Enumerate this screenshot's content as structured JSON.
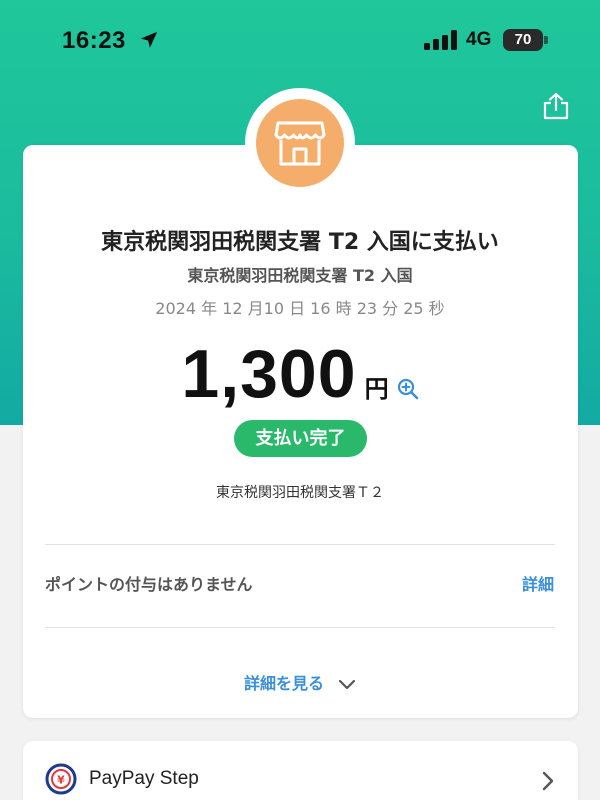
{
  "status_bar": {
    "time": "16:23",
    "network": "4G",
    "battery": "70",
    "icons": [
      "location-arrow-icon",
      "signal-bars-icon",
      "battery-icon"
    ]
  },
  "header": {
    "share_icon": "share-icon"
  },
  "payment": {
    "store_icon": "store-icon",
    "title": "東京税関羽田税関支署 T2 入国に支払い",
    "subtitle": "東京税関羽田税関支署 T2 入国",
    "datetime": "2024 年 12 月10 日 16 時 23 分 25 秒",
    "amount": "1,300",
    "currency": "円",
    "status": "支払い完了",
    "terminal": "東京税関羽田税関支署Ｔ２"
  },
  "points": {
    "label": "ポイントの付与はありません",
    "detail_link": "詳細"
  },
  "details_toggle": {
    "label": "詳細を見る"
  },
  "step": {
    "label": "PayPay Step"
  },
  "colors": {
    "header_top": "#1fc79a",
    "header_bottom": "#13aaa3",
    "store_avatar": "#f5ad6b",
    "status_badge": "#2ab96a",
    "link": "#3a8fd9"
  }
}
